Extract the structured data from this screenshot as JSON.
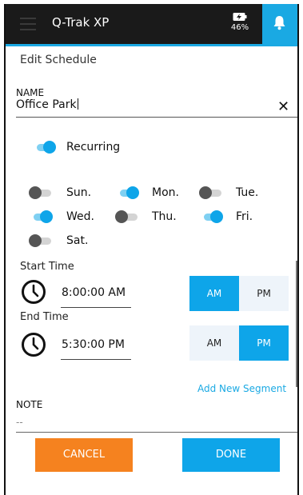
{
  "header": {
    "title": "Q-Trak XP",
    "battery_percent": "46%",
    "accent_color": "#1aa9e3",
    "icons": {
      "menu": "hamburger-icon",
      "battery": "battery-charging-icon",
      "notifications": "bell-icon"
    }
  },
  "screen": {
    "title": "Edit Schedule"
  },
  "name_field": {
    "label": "NAME",
    "value": "Office Park",
    "clear_symbol": "✕"
  },
  "recurring": {
    "label": "Recurring",
    "on": true
  },
  "days": [
    {
      "label": "Sun.",
      "on": false
    },
    {
      "label": "Mon.",
      "on": true
    },
    {
      "label": "Tue.",
      "on": false
    },
    {
      "label": "Wed.",
      "on": true
    },
    {
      "label": "Thu.",
      "on": false
    },
    {
      "label": "Fri.",
      "on": true
    },
    {
      "label": "Sat.",
      "on": false
    }
  ],
  "start_time": {
    "label": "Start Time",
    "value": "8:00:00 AM",
    "am_label": "AM",
    "pm_label": "PM",
    "selected": "AM"
  },
  "end_time": {
    "label": "End Time",
    "value": "5:30:00 PM",
    "am_label": "AM",
    "pm_label": "PM",
    "selected": "PM"
  },
  "add_segment": {
    "label": "Add New Segment"
  },
  "note": {
    "label": "NOTE",
    "value": "--"
  },
  "actions": {
    "cancel_label": "CANCEL",
    "done_label": "DONE",
    "cancel_color": "#f5821f",
    "done_color": "#0ea5e9"
  }
}
